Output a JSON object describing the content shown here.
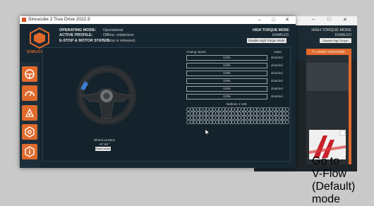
{
  "background_window": {
    "title_bar_controls": [
      "–",
      "□",
      "✕"
    ],
    "torque_mode_label": "HIGH TORQUE MODE",
    "torque_mode_value": "ENABLED",
    "torque_button": "Disable High Torque Mode",
    "login_label": "LOGIN / REGISTER",
    "firmware_button": "Go to V-Flow (Default) mode"
  },
  "main_window": {
    "title": "Simucube 2 True Drive 2022.9",
    "controls": [
      "–",
      "□",
      "✕"
    ],
    "brand": "SIMUCUBE",
    "status": {
      "operating_mode_label": "OPERATING MODE:",
      "operating_mode_value": "Operational",
      "active_profile_label": "ACTIVE PROFILE:",
      "active_profile_value": "Offline: rotate/one",
      "estop_label": "E-STOP & MOTOR STATUS:",
      "estop_value": "E-Stop is released."
    },
    "torque_mode_label": "HIGH TORQUE MODE",
    "torque_mode_value": "ENABLED",
    "torque_button": "Disable High Torque Mode",
    "sidebar_icons": [
      "wheel-icon",
      "gauge-icon",
      "tuning-icon",
      "gear-icon",
      "info-icon"
    ],
    "wheel_position_label": "Wheel position",
    "wheel_position_value": "-87.80 °",
    "reset_center_button": "Reset center",
    "analog_inputs_label": "Analog inputs",
    "value_header": "value",
    "analog_inputs": [
      {
        "value": "0.0%",
        "status": "disabled"
      },
      {
        "value": "0.0%",
        "status": "disabled"
      },
      {
        "value": "0.0%",
        "status": "disabled"
      },
      {
        "value": "0.0%",
        "status": "disabled"
      },
      {
        "value": "0.0%",
        "status": "disabled"
      },
      {
        "value": "0.0%",
        "status": "disabled"
      }
    ],
    "buttons_label": "Buttons 1-128"
  }
}
